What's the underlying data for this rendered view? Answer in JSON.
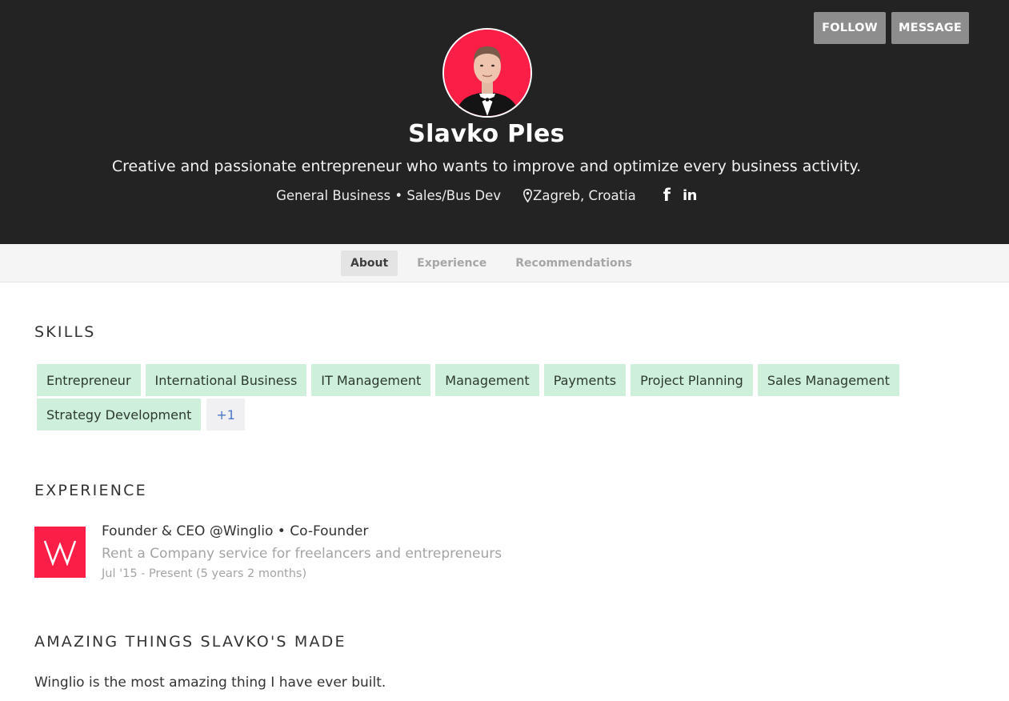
{
  "header": {
    "follow_label": "FOLLOW",
    "message_label": "MESSAGE",
    "name": "Slavko Ples",
    "tagline": "Creative and passionate entrepreneur who wants to improve and optimize every business activity.",
    "category": "General Business • Sales/Bus Dev",
    "location": "Zagreb, Croatia",
    "social_icons": [
      "facebook-icon",
      "linkedin-icon"
    ],
    "avatar_background": "#fb1f47"
  },
  "tabs": [
    {
      "label": "About",
      "active": true
    },
    {
      "label": "Experience",
      "active": false
    },
    {
      "label": "Recommendations",
      "active": false
    }
  ],
  "skills": {
    "title": "SKILLS",
    "items": [
      "Entrepreneur",
      "International Business",
      "IT Management",
      "Management",
      "Payments",
      "Project Planning",
      "Sales Management",
      "Strategy Development"
    ],
    "more_label": "+1"
  },
  "experience": {
    "title": "EXPERIENCE",
    "items": [
      {
        "logo_letter": "W",
        "role": "Founder & CEO @Winglio • Co-Founder",
        "description": "Rent a Company service for freelancers and entrepreneurs",
        "dates": "Jul '15 - Present (5 years 2 months)"
      }
    ]
  },
  "made": {
    "title": "AMAZING THINGS SLAVKO'S MADE",
    "text": "Winglio is the most amazing thing I have ever built."
  },
  "colors": {
    "header_bg": "#232323",
    "brand_red": "#fb1f47",
    "skill_chip_bg": "#ceefd9",
    "button_bg": "#8d8d8d"
  }
}
